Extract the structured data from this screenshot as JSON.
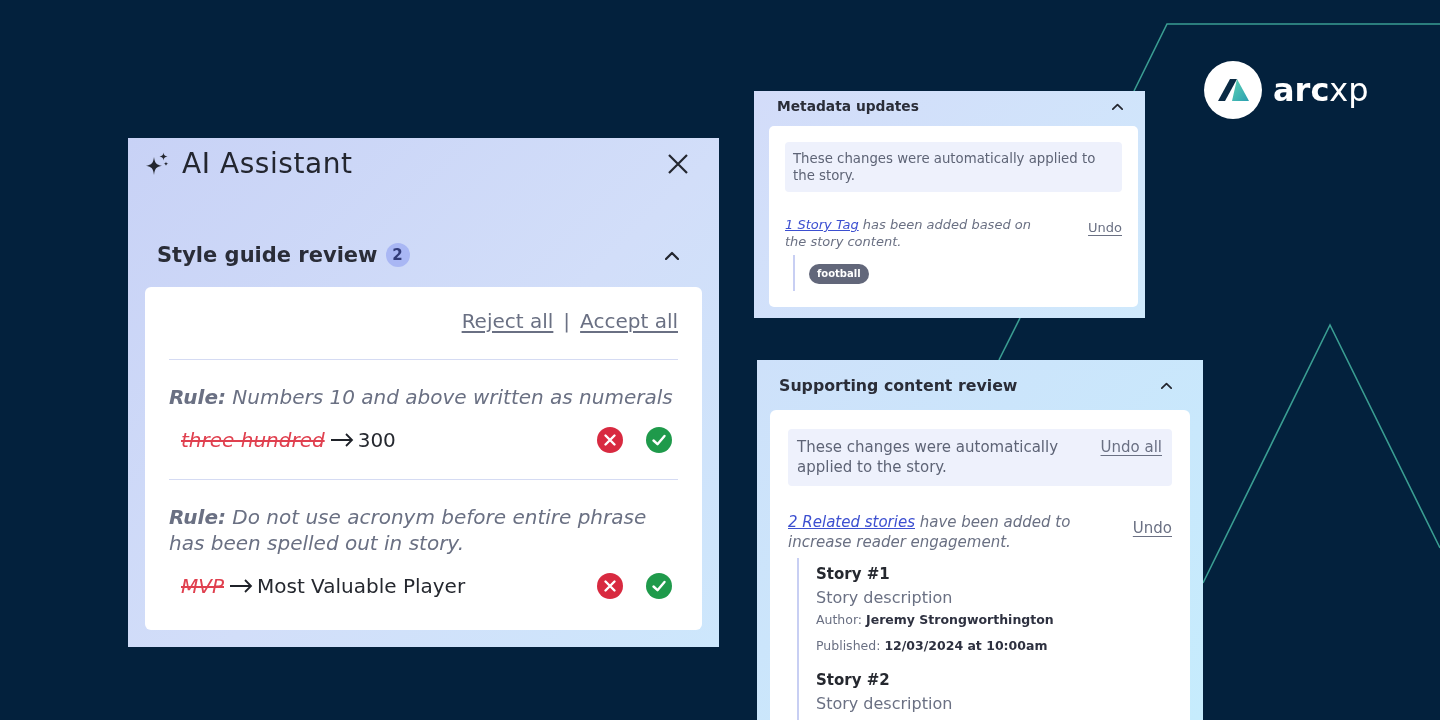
{
  "logo": {
    "wordmark": "**arc**xp"
  },
  "assistant": {
    "title": "AI Assistant",
    "section": {
      "title": "Style guide review",
      "count": "2",
      "expanded": true,
      "reject_all": "Reject all",
      "separator": "|",
      "accept_all": "Accept all",
      "suggestions": [
        {
          "rule": "**Rule:** Numbers 10 and above written as numerals",
          "original": "three hundred",
          "replacement": "300"
        },
        {
          "rule": "**Rule:** Do not use acronym before entire phrase has been spelled out in story.",
          "original": "MVP",
          "replacement": "Most Valuable Player"
        }
      ]
    }
  },
  "metadata_updates": {
    "title": "Metadata updates",
    "expanded": true,
    "notice": "These changes were automatically applied to the story.",
    "change": {
      "link": "1 Story Tag",
      "text": "has been added based on the story content.",
      "action": "Undo",
      "tags": [
        "football"
      ]
    }
  },
  "supporting_content_review": {
    "title": "Supporting content review",
    "expanded": true,
    "notice": "These changes were automatically applied to the story.",
    "notice_action": "Undo all",
    "change": {
      "link": "2 Related stories",
      "text": "have been added to increase reader engagement.",
      "action": "Undo",
      "stories": [
        {
          "title": "Story #1",
          "description": "Story description",
          "author": "Author: **Jeremy Strongworthington**",
          "published": "Published: **12/03/2024 at 10:00am**"
        },
        {
          "title": "Story #2",
          "description": "Story description"
        }
      ]
    }
  }
}
